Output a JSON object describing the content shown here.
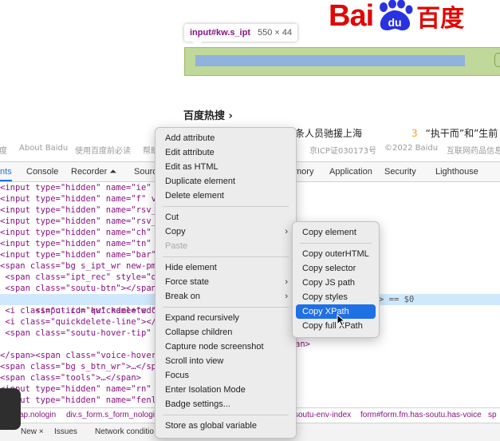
{
  "page": {
    "logo_left": "Bai",
    "logo_right": "百度",
    "tooltip": {
      "selector": "input#kw.s_ipt",
      "dims": "550 × 44"
    },
    "hot_title": "百度热搜 ›",
    "hot_items": [
      "条人员驰援上海",
      "“执干而”和”生前"
    ],
    "hot_item2_num": "3",
    "footer": [
      "度",
      "About Baidu",
      "使用百度前必读",
      "帮助",
      "京ICP证030173号",
      "©2022 Baidu",
      "互联网药品信息"
    ]
  },
  "devtools": {
    "tabs": [
      "nts",
      "Console",
      "Recorder ⏶",
      "Sourc",
      "mory",
      "Application",
      "Security",
      "Lighthouse"
    ],
    "lines": [
      "<input type=\"hidden\" name=\"ie\" va",
      "<input type=\"hidden\" name=\"f\" val",
      "<input type=\"hidden\" name=\"rsv_bp",
      "<input type=\"hidden\" name=\"rsv_id",
      "<input type=\"hidden\" name=\"ch\" va",
      "<input type=\"hidden\" name=\"tn\" va",
      "<input type=\"hidden\" name=\"bar\" va",
      "<span class=\"bg s_ipt_wr new-pmd",
      " <span class=\"ipt_rec\" style=\"dis",
      " <span class=\"soutu-btn\"></span>",
      " <input id=\"kw\" name=\"wd\" class=\"",
      " <i class=\"c-icon quickdelete c-c",
      " <i class=\"quickdelete-line\"></i>",
      " <span class=\"soutu-hover-tip\" st",
      " <span class=\"voice-hover\" style=",
      "</span>",
      "<span class=\"bg s_btn_wr\">…</span>",
      "<span class=\"tools\">…</span>",
      "<input type=\"hidden\" name=\"rn\" va",
      "<input type=\"hidden\" name=\"fenlei"
    ],
    "selected_tail": "> == $0",
    "line_tail_span": "an>",
    "breadcrumbs": [
      "ap.nologin",
      "div.s_form.s_form_nologin",
      "soutu-env-index",
      "form#form.fm.has-soutu.has-voice",
      "sp"
    ],
    "drawer_tabs": [
      "New ×",
      "Issues",
      "Network conditio"
    ]
  },
  "context_menu": {
    "items": [
      {
        "label": "Add attribute"
      },
      {
        "label": "Edit attribute"
      },
      {
        "label": "Edit as HTML"
      },
      {
        "label": "Duplicate element"
      },
      {
        "label": "Delete element"
      },
      {
        "label": "Cut"
      },
      {
        "label": "Copy",
        "submenu": true
      },
      {
        "label": "Paste",
        "disabled": true
      },
      {
        "label": "Hide element"
      },
      {
        "label": "Force state",
        "submenu": true
      },
      {
        "label": "Break on",
        "submenu": true
      },
      {
        "label": "Expand recursively"
      },
      {
        "label": "Collapse children"
      },
      {
        "label": "Capture node screenshot"
      },
      {
        "label": "Scroll into view"
      },
      {
        "label": "Focus"
      },
      {
        "label": "Enter Isolation Mode"
      },
      {
        "label": "Badge settings..."
      },
      {
        "label": "Store as global variable"
      }
    ]
  },
  "copy_submenu": {
    "items": [
      {
        "label": "Copy element"
      },
      {
        "label": "Copy outerHTML"
      },
      {
        "label": "Copy selector"
      },
      {
        "label": "Copy JS path"
      },
      {
        "label": "Copy styles"
      },
      {
        "label": "Copy XPath",
        "highlighted": true
      },
      {
        "label": "Copy full XPath"
      }
    ]
  },
  "colors": {
    "highlight": "#1f6fe5",
    "baidu_red": "#e10602",
    "baidu_blue": "#2932e1"
  }
}
